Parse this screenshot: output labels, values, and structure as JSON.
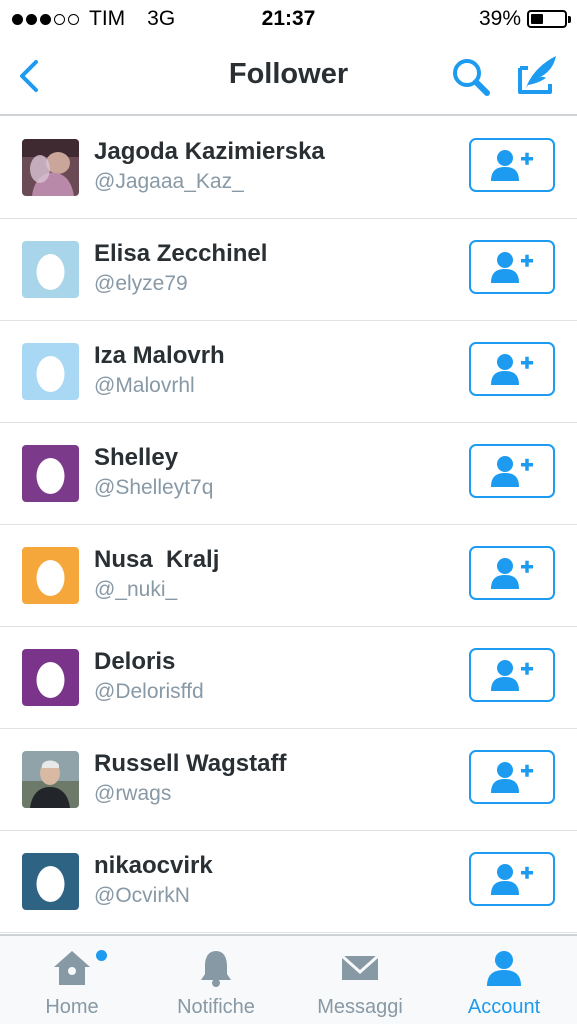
{
  "status_bar": {
    "carrier": "TIM",
    "network": "3G",
    "time": "21:37",
    "battery_percent": "39%",
    "battery_level": 0.39,
    "signal_bars_filled": 3,
    "signal_bars_total": 5
  },
  "nav": {
    "title": "Follower",
    "back_icon": "chevron-left-icon",
    "search_icon": "search-icon",
    "compose_icon": "compose-tweet-icon"
  },
  "colors": {
    "accent": "#1d9bf0",
    "text_primary": "#292f33",
    "text_secondary": "#8899a6"
  },
  "followers": [
    {
      "name": "Jagoda Kazimierska",
      "handle": "@Jagaaa_Kaz_",
      "avatar": "photo",
      "avatar_color": "#6a4a55"
    },
    {
      "name": "Elisa Zecchinel",
      "handle": "@elyze79",
      "avatar": "egg",
      "avatar_color": "#a8d5ea"
    },
    {
      "name": "Iza Malovrh",
      "handle": "@Malovrhl",
      "avatar": "egg",
      "avatar_color": "#a9d8f5"
    },
    {
      "name": "Shelley",
      "handle": "@Shelleyt7q",
      "avatar": "egg",
      "avatar_color": "#7c3a8a"
    },
    {
      "name": "Nusa  Kralj",
      "handle": "@_nuki_",
      "avatar": "egg",
      "avatar_color": "#f5a73c"
    },
    {
      "name": "Deloris",
      "handle": "@Delorisffd",
      "avatar": "egg",
      "avatar_color": "#7a3489"
    },
    {
      "name": "Russell Wagstaff",
      "handle": "@rwags",
      "avatar": "photo",
      "avatar_color": "#6d7a6a"
    },
    {
      "name": "nikaocvirk",
      "handle": "@OcvirkN",
      "avatar": "egg",
      "avatar_color": "#2e6384"
    }
  ],
  "follow_button_icon": "add-user-icon",
  "tabs": [
    {
      "label": "Home",
      "icon": "home-icon",
      "active": false,
      "badge": true
    },
    {
      "label": "Notifiche",
      "icon": "bell-icon",
      "active": false,
      "badge": false
    },
    {
      "label": "Messaggi",
      "icon": "envelope-icon",
      "active": false,
      "badge": false
    },
    {
      "label": "Account",
      "icon": "person-icon",
      "active": true,
      "badge": false
    }
  ]
}
